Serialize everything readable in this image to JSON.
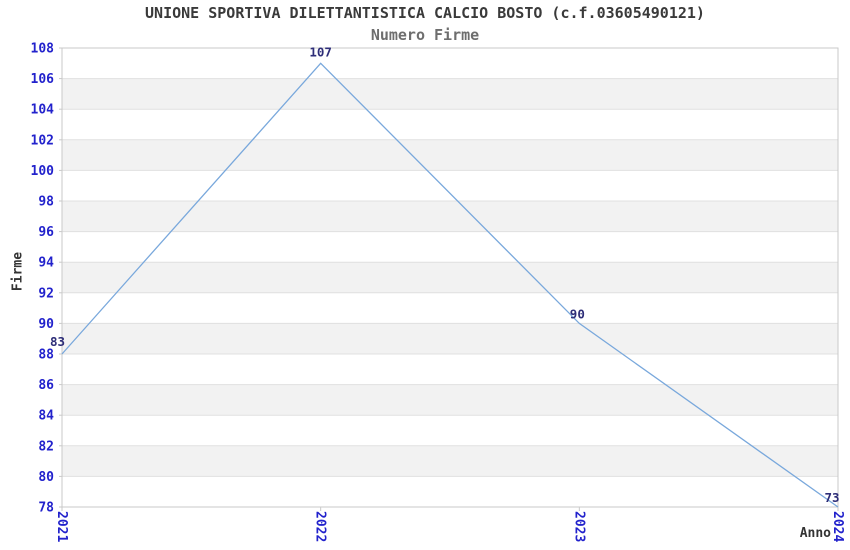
{
  "header": {
    "title": "UNIONE SPORTIVA DILETTANTISTICA CALCIO BOSTO (c.f.03605490121)",
    "subtitle": "Numero Firme"
  },
  "chart_data": {
    "type": "line",
    "title": "UNIONE SPORTIVA DILETTANTISTICA CALCIO BOSTO (c.f.03605490121)",
    "subtitle": "Numero Firme",
    "xlabel": "Anno",
    "ylabel": "Firme",
    "categories": [
      "2021",
      "2022",
      "2023",
      "2024"
    ],
    "series": [
      {
        "name": "Numero Firme",
        "values": [
          83,
          107,
          90,
          73
        ],
        "plotted_values": [
          88,
          107,
          90,
          78
        ],
        "point_labels": [
          "83",
          "107",
          "90",
          "73"
        ]
      }
    ],
    "ylim": [
      78,
      108
    ],
    "ytick_step": 2,
    "grid": true,
    "banded_background": true,
    "legend": "none"
  },
  "colors": {
    "title": "#3a3a3a",
    "subtitle": "#6e6e6e",
    "axis_title": "#333333",
    "axis_tick_label": "#2222cc",
    "point_label": "#2e2e78",
    "line": "#79a8dc",
    "band": "#f2f2f2",
    "gridline": "#e0e0e0",
    "plot_border": "#c9c9c9",
    "background": "#ffffff"
  }
}
